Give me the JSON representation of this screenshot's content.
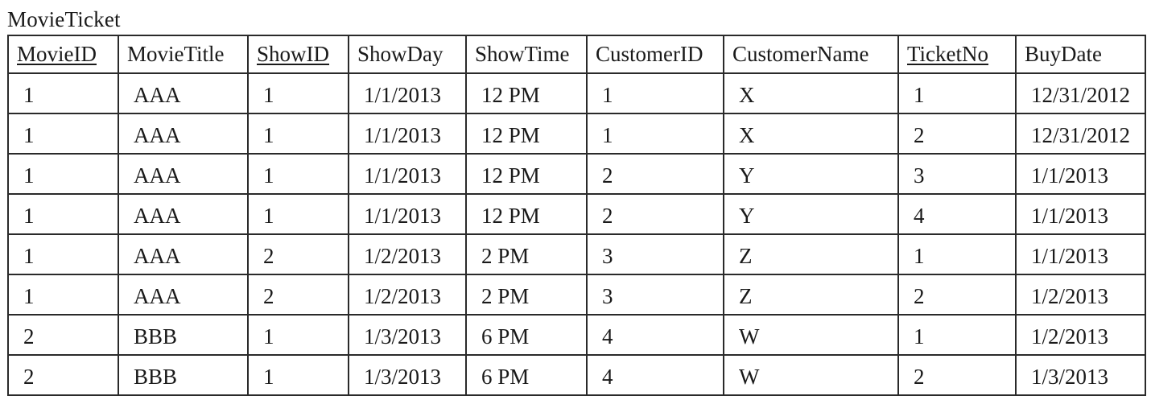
{
  "title": "MovieTicket",
  "columns": [
    {
      "label": "MovieID",
      "key": true
    },
    {
      "label": "MovieTitle",
      "key": false
    },
    {
      "label": "ShowID",
      "key": true
    },
    {
      "label": "ShowDay",
      "key": false
    },
    {
      "label": "ShowTime",
      "key": false
    },
    {
      "label": "CustomerID",
      "key": false
    },
    {
      "label": "CustomerName",
      "key": false
    },
    {
      "label": "TicketNo",
      "key": true
    },
    {
      "label": "BuyDate",
      "key": false
    }
  ],
  "rows": [
    [
      "1",
      "AAA",
      "1",
      "1/1/2013",
      "12 PM",
      "1",
      "X",
      "1",
      "12/31/2012"
    ],
    [
      "1",
      "AAA",
      "1",
      "1/1/2013",
      "12 PM",
      "1",
      "X",
      "2",
      "12/31/2012"
    ],
    [
      "1",
      "AAA",
      "1",
      "1/1/2013",
      "12 PM",
      "2",
      "Y",
      "3",
      "1/1/2013"
    ],
    [
      "1",
      "AAA",
      "1",
      "1/1/2013",
      "12 PM",
      "2",
      "Y",
      "4",
      "1/1/2013"
    ],
    [
      "1",
      "AAA",
      "2",
      "1/2/2013",
      "2 PM",
      "3",
      "Z",
      "1",
      "1/1/2013"
    ],
    [
      "1",
      "AAA",
      "2",
      "1/2/2013",
      "2 PM",
      "3",
      "Z",
      "2",
      "1/2/2013"
    ],
    [
      "2",
      "BBB",
      "1",
      "1/3/2013",
      "6 PM",
      "4",
      "W",
      "1",
      "1/2/2013"
    ],
    [
      "2",
      "BBB",
      "1",
      "1/3/2013",
      "6 PM",
      "4",
      "W",
      "2",
      "1/3/2013"
    ]
  ]
}
